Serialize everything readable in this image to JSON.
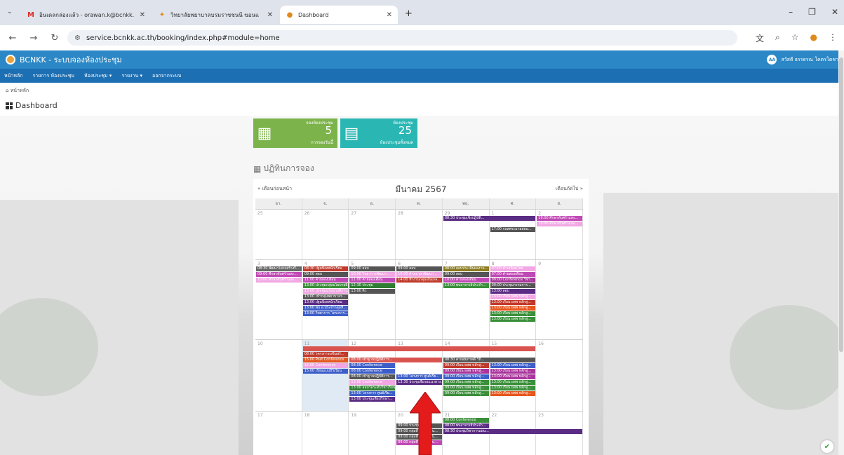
{
  "browser": {
    "tabs": [
      {
        "title": "อินเดลกล่องแล้ว - orawan.k@bcnkk.",
        "icon": "gmail-icon"
      },
      {
        "title": "วิทยาลัยพยาบาลบรมราชชนนี ขอนแ",
        "icon": "college-icon"
      },
      {
        "title": "Dashboard",
        "icon": "college-icon"
      }
    ],
    "new_tab": "+",
    "url": "service.bcnkk.ac.th/booking/index.php#module=home"
  },
  "app": {
    "title": "BCNKK - ระบบจองห้องประชุม",
    "user": "สวัสดี ธรรธรณ โคตรโตชา",
    "user_initials": "AA",
    "menu": [
      "หน้าหลัก",
      "รายการ ห้องประชุม",
      "ห้องประชุม ▾",
      "รายงาน ▾",
      "ออกจากระบบ"
    ],
    "breadcrumb": "หน้าหลัก",
    "page_title": "Dashboard"
  },
  "stats": [
    {
      "label": "จองห้องประชุม",
      "value": "5",
      "sub": "การจองวันนี้",
      "color": "#7cb34a"
    },
    {
      "label": "ห้องประชุม",
      "value": "25",
      "sub": "ห้องประชุมทั้งหมด",
      "color": "#2ab7b4"
    }
  ],
  "calendar": {
    "section_title": "ปฏิทินการจอง",
    "prev": "« เดือนก่อนหน้า",
    "next": "เดือนถัดไป »",
    "month": "มีนาคม 2567",
    "dow": [
      "อา.",
      "จ.",
      "อ.",
      "พ.",
      "พฤ.",
      "ศ.",
      "ส."
    ],
    "weeks": [
      {
        "days": [
          "25",
          "26",
          "27",
          "28",
          "29",
          "1",
          "2"
        ],
        "events": [
          {
            "col": 4,
            "span": 2,
            "row": 0,
            "text": "08:30 ประชุมเชิงปฏิบัติ...",
            "color": "#5b2c83"
          },
          {
            "col": 6,
            "span": 1,
            "row": 0,
            "text": "10:00 ศึกษาดับศร้าและ...",
            "color": "#c04ab5"
          },
          {
            "col": 6,
            "span": 1,
            "row": 1,
            "text": "10:00 ศึกษาดับศร้าและ...",
            "color": "#f2a7e4"
          },
          {
            "col": 5,
            "span": 1,
            "row": 2,
            "text": "17:00 กอสพระมายสอน...",
            "color": "#555"
          }
        ]
      },
      {
        "days": [
          "3",
          "4",
          "5",
          "6",
          "7",
          "8",
          "9"
        ],
        "events": [
          {
            "col": 0,
            "span": 1,
            "row": 0,
            "text": "08:30 พัฒนาโครงสร้างรี...",
            "color": "#666"
          },
          {
            "col": 1,
            "span": 1,
            "row": 0,
            "text": "08:30 ปฐมนิเทศนักเรียน",
            "color": "#c0392b"
          },
          {
            "col": 2,
            "span": 1,
            "row": 0,
            "text": "09:00 สอบ",
            "color": "#555"
          },
          {
            "col": 3,
            "span": 1,
            "row": 0,
            "text": "09:00 สอบ",
            "color": "#555"
          },
          {
            "col": 4,
            "span": 1,
            "row": 0,
            "text": "08:00 สอบประเมินผลงาน...",
            "color": "#8a7a1f"
          },
          {
            "col": 5,
            "span": 1,
            "row": 0,
            "text": "07:00 ทำเสนียมไทย",
            "color": "#f2a7e4"
          },
          {
            "col": 0,
            "span": 1,
            "row": 1,
            "text": "09:00 ศึกษาดับศร้าและ...",
            "color": "#c04ab5"
          },
          {
            "col": 1,
            "span": 1,
            "row": 1,
            "text": "09:00 สอบ",
            "color": "#555"
          },
          {
            "col": 2,
            "span": 1,
            "row": 1,
            "text": "10:00 วิทยาการพัฒนา...",
            "color": "#f2a7e4"
          },
          {
            "col": 3,
            "span": 1,
            "row": 1,
            "text": "10:00 ค้ายอาสาพัฒนา...",
            "color": "#f2a7e4"
          },
          {
            "col": 4,
            "span": 1,
            "row": 1,
            "text": "09:00 สอบ",
            "color": "#555"
          },
          {
            "col": 5,
            "span": 1,
            "row": 1,
            "text": "07:00 ค้ายสองเดือน",
            "color": "#c04ab5"
          },
          {
            "col": 0,
            "span": 1,
            "row": 2,
            "text": "10:00 ศึกษาดับศร้าและ...",
            "color": "#f2a7e4"
          },
          {
            "col": 1,
            "span": 1,
            "row": 2,
            "text": "11:00 ค้ายสองเดือน",
            "color": "#c04ab5"
          },
          {
            "col": 2,
            "span": 1,
            "row": 2,
            "text": "11:00 ค้ายสองเดือน",
            "color": "#c04ab5"
          },
          {
            "col": 3,
            "span": 1,
            "row": 2,
            "text": "14:00 ทำงานกลุ่มเอ็นเกล...",
            "color": "#c0392b"
          },
          {
            "col": 4,
            "span": 1,
            "row": 2,
            "text": "10:00 ค้ายสองเดือน",
            "color": "#c04ab5"
          },
          {
            "col": 5,
            "span": 1,
            "row": 2,
            "text": "09:00 Conference วิชา...",
            "color": "#a8359b"
          },
          {
            "col": 1,
            "span": 1,
            "row": 3,
            "text": "13:00 ประชุมกลุ่มนโยบายธิ...",
            "color": "#3a8f3a"
          },
          {
            "col": 2,
            "span": 1,
            "row": 3,
            "text": "12:30 ประชุม",
            "color": "#2e7d32"
          },
          {
            "col": 4,
            "span": 1,
            "row": 3,
            "text": "13:00 พบอาจารย์ประจำ...",
            "color": "#3a8f3a"
          },
          {
            "col": 5,
            "span": 1,
            "row": 3,
            "text": "09:00 ประชุมกรรมการ...",
            "color": "#555"
          },
          {
            "col": 1,
            "span": 1,
            "row": 4,
            "text": "13:00 ประชุมนโยบายที่การ...",
            "color": "#f2a7e4"
          },
          {
            "col": 2,
            "span": 1,
            "row": 4,
            "text": "13:00 ติว",
            "color": "#555"
          },
          {
            "col": 5,
            "span": 1,
            "row": 4,
            "text": "13:00 สอบ",
            "color": "#5b2c83"
          },
          {
            "col": 1,
            "span": 1,
            "row": 5,
            "text": "13:00 เข้ากลุ่มพยาบาลร...",
            "color": "#555"
          },
          {
            "col": 5,
            "span": 1,
            "row": 5,
            "text": "13:00 เรียน ยสพ หลักสู...",
            "color": "#f2a7e4"
          },
          {
            "col": 1,
            "span": 1,
            "row": 6,
            "text": "13:00 ปฐมนิเทศนักเรียน",
            "color": "#5b2c83"
          },
          {
            "col": 5,
            "span": 1,
            "row": 6,
            "text": "13:00 เรียน ยสพ หลักสู...",
            "color": "#c0392b"
          },
          {
            "col": 1,
            "span": 1,
            "row": 7,
            "text": "13:00 พบ อ.ประจำกลุ่มที...",
            "color": "#3d5ec9"
          },
          {
            "col": 5,
            "span": 1,
            "row": 7,
            "text": "13:00 เรียน ยสพ หลักสู...",
            "color": "#e6561e"
          },
          {
            "col": 1,
            "span": 1,
            "row": 8,
            "text": "13:00 วิทยาการ โครงการ...",
            "color": "#3d5ec9"
          },
          {
            "col": 5,
            "span": 1,
            "row": 8,
            "text": "13:00 เรียน ยสพ หลักสู...",
            "color": "#3a8f3a"
          },
          {
            "col": 5,
            "span": 1,
            "row": 9,
            "text": "13:00 เรียน ยสพ หลักสู...",
            "color": "#3a8f3a"
          }
        ]
      },
      {
        "days": [
          "10",
          "11",
          "12",
          "13",
          "14",
          "15",
          "16"
        ],
        "events": [
          {
            "col": 1,
            "span": 5,
            "row": 0,
            "text": "",
            "color": "#d9534f"
          },
          {
            "col": 1,
            "span": 1,
            "row": 1,
            "text": "08:00 โครงการเสริมสร้...",
            "color": "#c0392b"
          },
          {
            "col": 1,
            "span": 1,
            "row": 2,
            "text": "15:00 Post Conference",
            "color": "#e6561e"
          },
          {
            "col": 2,
            "span": 2,
            "row": 2,
            "text": "08:00 เข้าฐานปฏิบัติการ...",
            "color": "#d9534f"
          },
          {
            "col": 4,
            "span": 2,
            "row": 2,
            "text": "08:30 ค่ายสุขภาพดี วิถี...",
            "color": "#555"
          },
          {
            "col": 1,
            "span": 1,
            "row": 3,
            "text": "15:00 Conference",
            "color": "#f2a7e4"
          },
          {
            "col": 2,
            "span": 1,
            "row": 3,
            "text": "08:00 Conference",
            "color": "#3d5ec9"
          },
          {
            "col": 4,
            "span": 1,
            "row": 3,
            "text": "09:00 เรียน ยสพ หลักสู...",
            "color": "#c0392b"
          },
          {
            "col": 5,
            "span": 1,
            "row": 3,
            "text": "13:00 เรียน ยสพ หลักสู...",
            "color": "#3d5ec9"
          },
          {
            "col": 1,
            "span": 1,
            "row": 4,
            "text": "15:00 เรียนแบบปีวิเวียน",
            "color": "#3d5ec9"
          },
          {
            "col": 2,
            "span": 1,
            "row": 4,
            "text": "08:00 Conference",
            "color": "#3d5ec9"
          },
          {
            "col": 4,
            "span": 1,
            "row": 4,
            "text": "09:00 เรียน ยสพ หลักสู...",
            "color": "#a8359b"
          },
          {
            "col": 5,
            "span": 1,
            "row": 4,
            "text": "13:00 เรียน ยสพ หลักสู...",
            "color": "#a8359b"
          },
          {
            "col": 2,
            "span": 1,
            "row": 5,
            "text": "08:00 เข้าฐานปฏิบัติการ...",
            "color": "#555"
          },
          {
            "col": 3,
            "span": 1,
            "row": 5,
            "text": "13:00 โครงการ ศูนย์เรีย...",
            "color": "#3d5ec9"
          },
          {
            "col": 4,
            "span": 1,
            "row": 5,
            "text": "09:00 เรียน ยสพ หลักสู...",
            "color": "#3d5ec9"
          },
          {
            "col": 5,
            "span": 1,
            "row": 5,
            "text": "13:00 เรียน ยสพ หลักสู...",
            "color": "#a8359b"
          },
          {
            "col": 2,
            "span": 1,
            "row": 6,
            "text": "13:00 Conference",
            "color": "#f2a7e4"
          },
          {
            "col": 3,
            "span": 1,
            "row": 6,
            "text": "13:30 ประชุมชี้แจงแนวทาง...",
            "color": "#5b2c83"
          },
          {
            "col": 4,
            "span": 1,
            "row": 6,
            "text": "09:00 เรียน ยสพ หลักสู...",
            "color": "#3a8f3a"
          },
          {
            "col": 5,
            "span": 1,
            "row": 6,
            "text": "13:00 เรียน ยสพ หลักสู...",
            "color": "#3a8f3a"
          },
          {
            "col": 2,
            "span": 1,
            "row": 7,
            "text": "13:00 สอบวัดระดับวิชาเรียน",
            "color": "#2e7d32"
          },
          {
            "col": 4,
            "span": 1,
            "row": 7,
            "text": "09:00 เรียน ยสพ หลักสู...",
            "color": "#3a8f3a"
          },
          {
            "col": 5,
            "span": 1,
            "row": 7,
            "text": "13:00 เรียน ยสพ หลักสู...",
            "color": "#3a8f3a"
          },
          {
            "col": 2,
            "span": 1,
            "row": 8,
            "text": "13:00 โครงการ ศูนย์เรีย...",
            "color": "#3d5ec9"
          },
          {
            "col": 4,
            "span": 1,
            "row": 8,
            "text": "09:00 เรียน ยสพ หลักสู...",
            "color": "#3a8f3a"
          },
          {
            "col": 5,
            "span": 1,
            "row": 8,
            "text": "13:00 เรียน ยสพ หลักสู...",
            "color": "#e6561e"
          },
          {
            "col": 2,
            "span": 1,
            "row": 9,
            "text": "13:00 ประชุมเพื่อปรึกษา...",
            "color": "#5b2c83"
          }
        ]
      },
      {
        "days": [
          "17",
          "18",
          "19",
          "20",
          "21",
          "22",
          "23"
        ],
        "events": [
          {
            "col": 4,
            "span": 1,
            "row": 0,
            "text": "08:00 Conference",
            "color": "#3a8f3a"
          },
          {
            "col": 4,
            "span": 1,
            "row": 1,
            "text": "08:00 พบอาจารย์ประจำ...",
            "color": "#5b2c83"
          },
          {
            "col": 3,
            "span": 1,
            "row": 1,
            "text": "09:00 ประชุม สมศ.",
            "color": "#555"
          },
          {
            "col": 4,
            "span": 3,
            "row": 2,
            "text": "08:30 ประชุมวิชาการแผน...",
            "color": "#5b2c83"
          },
          {
            "col": 3,
            "span": 1,
            "row": 2,
            "text": "09:00 กลุ่มที่ 3 ประเมิน...",
            "color": "#555"
          },
          {
            "col": 3,
            "span": 1,
            "row": 3,
            "text": "09:00 กลุ่มที่ 4 ประเมิน...",
            "color": "#555"
          },
          {
            "col": 3,
            "span": 1,
            "row": 4,
            "text": "09:00 กลุ่มที่ 5 ประเมิน...",
            "color": "#c04ab5"
          }
        ]
      }
    ]
  }
}
